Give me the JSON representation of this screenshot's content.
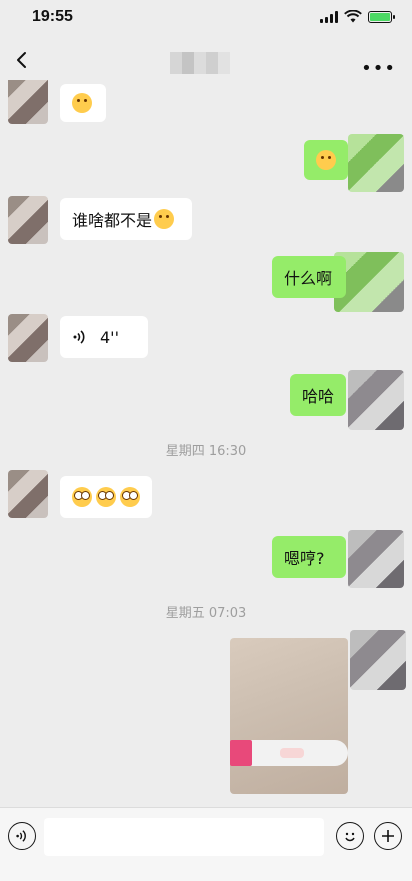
{
  "status_bar": {
    "time": "19:55"
  },
  "header": {
    "more_label": "•••"
  },
  "messages": {
    "m1": {
      "text": ""
    },
    "m2": {
      "text": ""
    },
    "m3": {
      "text": "谁啥都不是"
    },
    "m4": {
      "text": "什么啊"
    },
    "m5": {
      "duration": "4''"
    },
    "m6": {
      "text": "哈哈"
    },
    "timestamp1": "星期四 16:30",
    "m7": {
      "text": ""
    },
    "m8": {
      "text": "嗯哼?"
    },
    "timestamp2": "星期五 07:03"
  },
  "colors": {
    "sent_bubble": "#95ec69",
    "received_bubble": "#ffffff",
    "background": "#ededed"
  },
  "icons": {
    "back": "chevron-left-icon",
    "more": "more-icon",
    "voice": "voice-icon",
    "emoji": "emoji-icon",
    "plus": "plus-icon"
  }
}
